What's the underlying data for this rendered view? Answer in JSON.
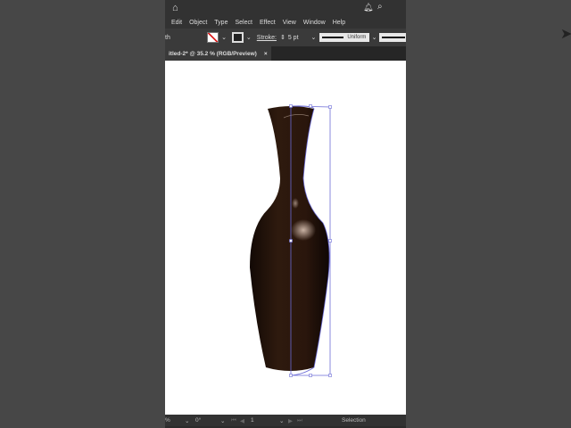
{
  "menu": [
    "Edit",
    "Object",
    "Type",
    "Select",
    "Effect",
    "View",
    "Window",
    "Help"
  ],
  "control": {
    "left_text": "th",
    "stroke_label": "Stroke:",
    "stroke_value": "5 pt",
    "profile": "Uniform"
  },
  "document": {
    "tab_title": "itled-2* @ 35.2 % (RGB/Preview)",
    "close": "×"
  },
  "status": {
    "zoom": "%",
    "rotation": "0°",
    "artboard": "1",
    "tool": "Selection"
  },
  "colors": {
    "vase": "#2a160c",
    "selection": "#6b6bd6"
  }
}
